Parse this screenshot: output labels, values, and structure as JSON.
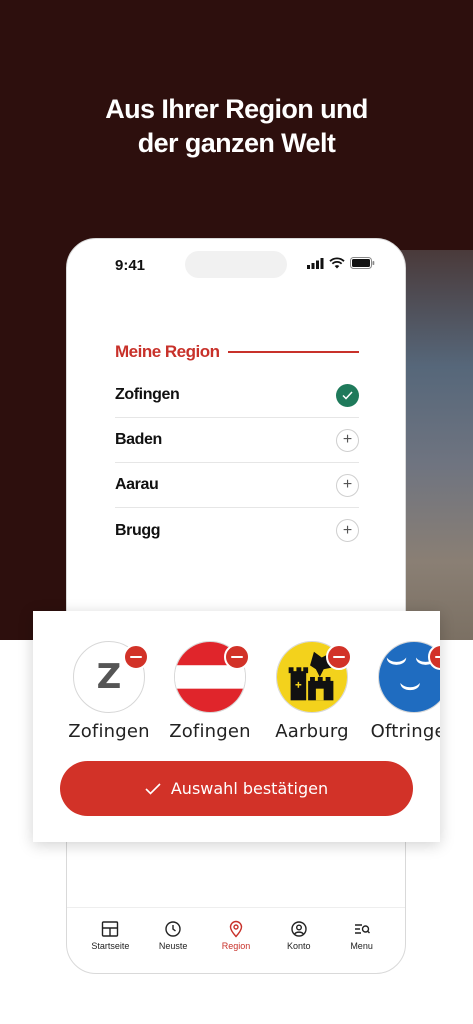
{
  "headline": {
    "line1": "Aus Ihrer Region und",
    "line2": "der ganzen Welt"
  },
  "status_bar": {
    "time": "9:41"
  },
  "region_section": {
    "title": "Meine Region",
    "items": [
      {
        "name": "Zofingen",
        "state": "selected"
      },
      {
        "name": "Baden",
        "state": "add"
      },
      {
        "name": "Aarau",
        "state": "add"
      },
      {
        "name": "Brugg",
        "state": "add"
      }
    ]
  },
  "selected_regions": [
    {
      "label": "Zofingen",
      "logo": "z-letter-logo",
      "monogram": "Z"
    },
    {
      "label": "Zofingen",
      "logo": "red-white-red-flag"
    },
    {
      "label": "Aarburg",
      "logo": "aarburg-coat-of-arms"
    },
    {
      "label": "Oftringen",
      "logo": "oftringen-coat-of-arms"
    }
  ],
  "confirm_button": {
    "label": "Auswahl bestätigen"
  },
  "tab_bar": {
    "tabs": [
      {
        "label": "Startseite",
        "icon": "layout-icon"
      },
      {
        "label": "Neuste",
        "icon": "clock-icon"
      },
      {
        "label": "Region",
        "icon": "location-pin-icon",
        "active": true
      },
      {
        "label": "Konto",
        "icon": "user-icon"
      },
      {
        "label": "Menu",
        "icon": "menu-search-icon"
      }
    ]
  },
  "colors": {
    "brand_red": "#c8312a",
    "dark_background": "#2d0f0d",
    "check_green": "#1f7a5b"
  }
}
